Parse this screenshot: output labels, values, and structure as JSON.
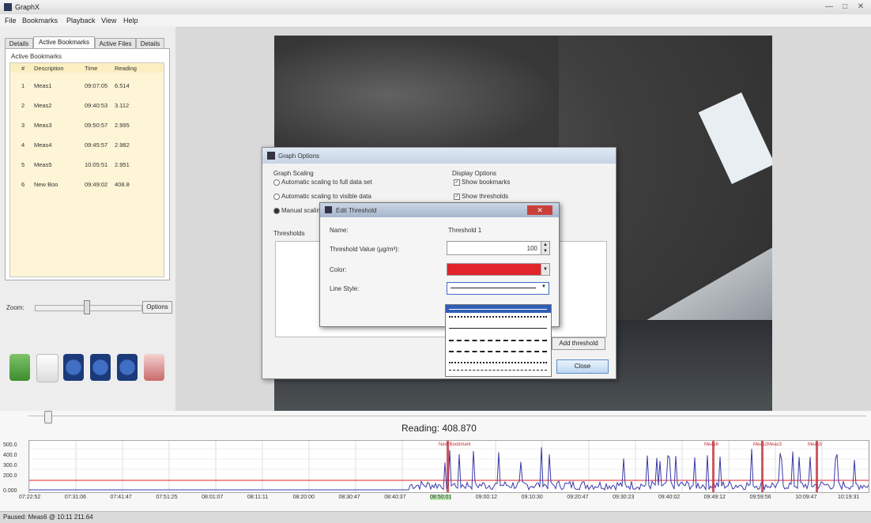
{
  "window": {
    "title": "GraphX",
    "min": "—",
    "max": "□",
    "close": "✕"
  },
  "menu": [
    "File",
    "Bookmarks",
    "Playback",
    "View",
    "Help"
  ],
  "tabs": [
    "Details",
    "Active Bookmarks",
    "Active Files",
    "Details"
  ],
  "bookmarks": {
    "group_label": "Active Bookmarks",
    "columns": [
      "#",
      "Description",
      "Time",
      "Reading"
    ],
    "rows": [
      [
        "1",
        "Meas1",
        "09:07:05",
        "6.514"
      ],
      [
        "2",
        "Meas2",
        "09:40:53",
        "3.112"
      ],
      [
        "3",
        "Meas3",
        "09:50:57",
        "2.995"
      ],
      [
        "4",
        "Meas4",
        "09:45:57",
        "2.982"
      ],
      [
        "5",
        "Meas5",
        "10:05:51",
        "2.951"
      ],
      [
        "6",
        "New Boo",
        "09:49:02",
        "408.8"
      ]
    ]
  },
  "zoom": {
    "label": "Zoom:",
    "options_button": "Options"
  },
  "media_icons": [
    "flag-icon",
    "page-icon",
    "prev-icon",
    "pause-icon",
    "stop-icon",
    "mute-icon"
  ],
  "graph_options": {
    "title": "Graph Options",
    "scaling_label": "Graph Scaling",
    "scaling_opts": [
      "Automatic scaling to full data set",
      "Automatic scaling to visible data",
      "Manual scaling"
    ],
    "display_label": "Display Options",
    "display_opts": [
      "Show bookmarks",
      "Show thresholds"
    ],
    "thresholds_label": "Thresholds",
    "add_button": "Add threshold",
    "close_button": "Close"
  },
  "edit_threshold": {
    "title": "Edit Threshold",
    "name_label": "Name:",
    "name_value": "Threshold 1",
    "value_label": "Threshold Value (µg/m³):",
    "value": "100",
    "color_label": "Color:",
    "color": "#e0242a",
    "linestyle_label": "Line Style:"
  },
  "timeline": {
    "reading": "Reading: 408.870",
    "yticks": [
      "500.0",
      "400.0",
      "300.0",
      "200.0",
      "0.000"
    ],
    "xticks": [
      "07:22:52",
      "07:31:06",
      "07:41:47",
      "07:51:25",
      "08:01:07",
      "08:11:11",
      "08:20:00",
      "08:30:47",
      "08:40:37",
      "08:50:01",
      "09:00:12",
      "09:10:30",
      "09:20:47",
      "09:30:23",
      "09:40:02",
      "09:49:12",
      "09:59:56",
      "10:09:47",
      "10:19:31"
    ],
    "bookmark_labels": [
      "New Bookmark",
      "Meas6",
      "Meas2Meas3",
      "Meas5"
    ],
    "threshold_color": "#e0242a",
    "series_color": "#3a3aa8"
  },
  "status": "Paused: Meas6 @ 10:11 211.64"
}
